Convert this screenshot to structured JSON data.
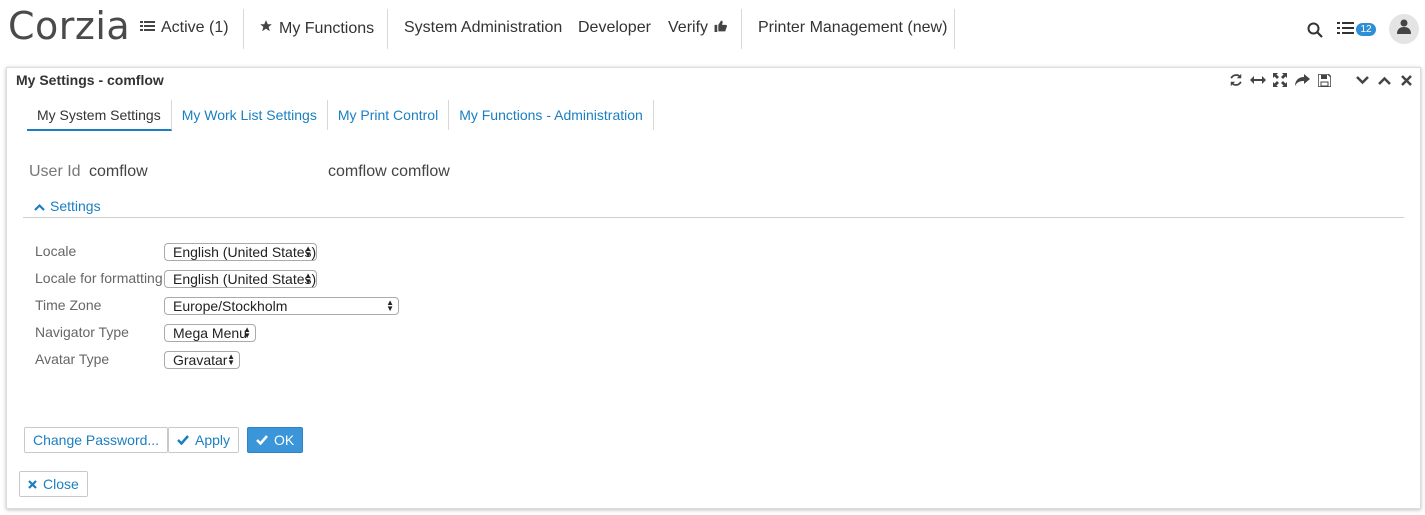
{
  "app": {
    "logo": "Corzia"
  },
  "nav": {
    "active_label": "Active (1)",
    "my_functions": "My Functions",
    "system_admin": "System Administration",
    "developer": "Developer",
    "verify": "Verify",
    "printer_mgmt": "Printer Management (new)",
    "notification_count": "12"
  },
  "window": {
    "title": "My Settings - comflow",
    "tabs": [
      {
        "label": "My System Settings"
      },
      {
        "label": "My Work List Settings"
      },
      {
        "label": "My Print Control"
      },
      {
        "label": "My Functions - Administration"
      }
    ]
  },
  "user": {
    "label": "User Id",
    "id": "comflow",
    "name": "comflow comflow"
  },
  "settings": {
    "toggle_label": "Settings",
    "fields": [
      {
        "label": "Locale",
        "value": "English (United States)"
      },
      {
        "label": "Locale for formatting",
        "value": "English (United States)"
      },
      {
        "label": "Time Zone",
        "value": "Europe/Stockholm"
      },
      {
        "label": "Navigator Type",
        "value": "Mega Menu"
      },
      {
        "label": "Avatar Type",
        "value": "Gravatar"
      }
    ]
  },
  "buttons": {
    "change_password": "Change Password...",
    "apply": "Apply",
    "ok": "OK",
    "close": "Close"
  },
  "colors": {
    "accent": "#1a7fc1",
    "primary_button": "#3a95d9",
    "badge": "#2f8fd6"
  },
  "icons": [
    "list-icon",
    "star-icon",
    "thumbs-up-icon",
    "search-icon",
    "task-list-icon",
    "user-icon",
    "refresh-icon",
    "resize-horizontal-icon",
    "expand-icon",
    "share-icon",
    "save-icon",
    "chevron-down-icon",
    "chevron-up-icon",
    "close-icon",
    "check-icon"
  ]
}
